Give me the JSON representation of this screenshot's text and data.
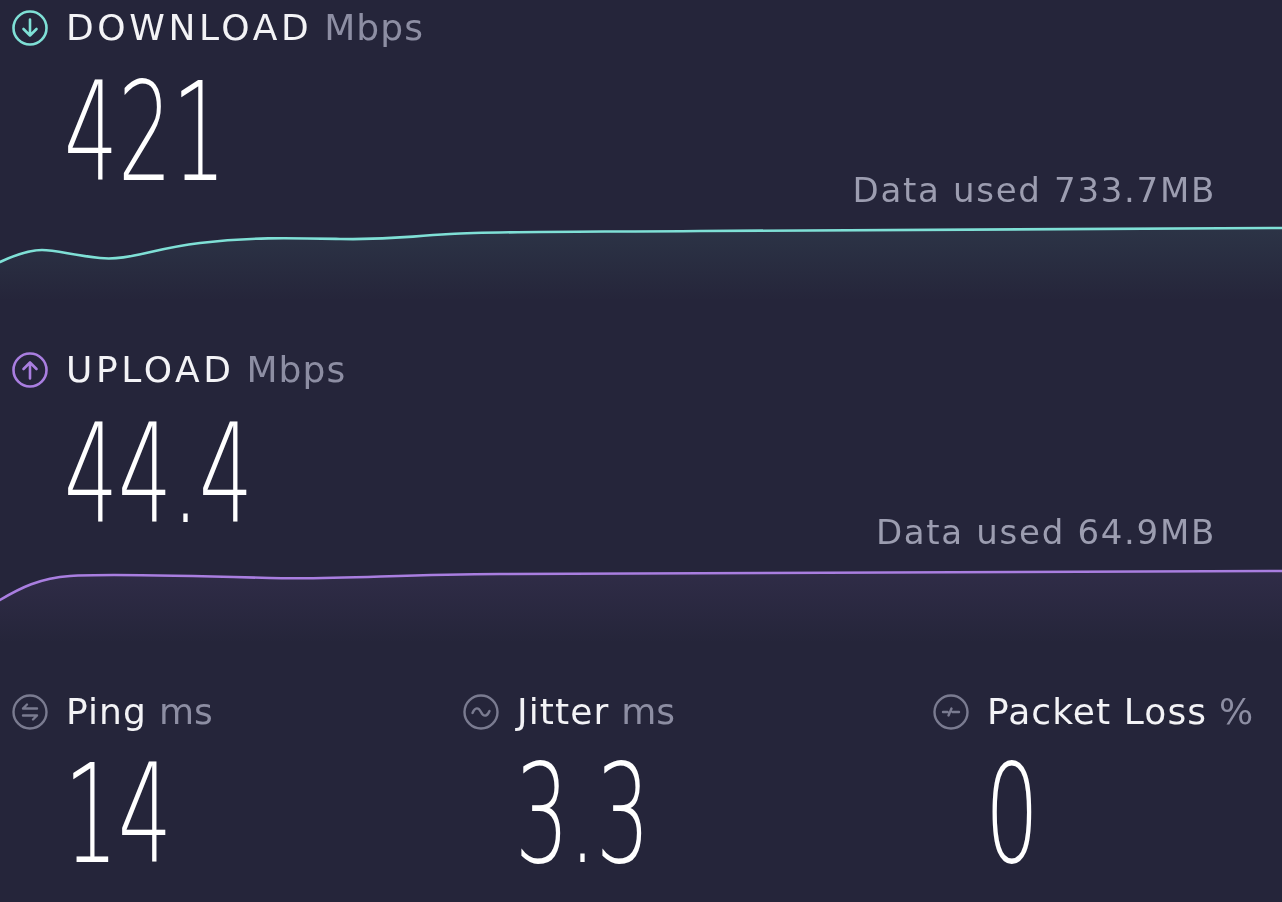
{
  "speeds": [
    {
      "kind": "download",
      "label": "DOWNLOAD",
      "unit": "Mbps",
      "value": "421",
      "data_used": "Data used 733.7MB",
      "color": "#7fe0d6"
    },
    {
      "kind": "upload",
      "label": "UPLOAD",
      "unit": "Mbps",
      "value": "44.4",
      "data_used": "Data used 64.9MB",
      "color": "#a97ee0"
    }
  ],
  "stats": [
    {
      "kind": "ping",
      "label": "Ping",
      "unit": "ms",
      "value": "14"
    },
    {
      "kind": "jitter",
      "label": "Jitter",
      "unit": "ms",
      "value": "3.3"
    },
    {
      "kind": "packet_loss",
      "label": "Packet Loss",
      "unit": "%",
      "value": "0"
    }
  ]
}
